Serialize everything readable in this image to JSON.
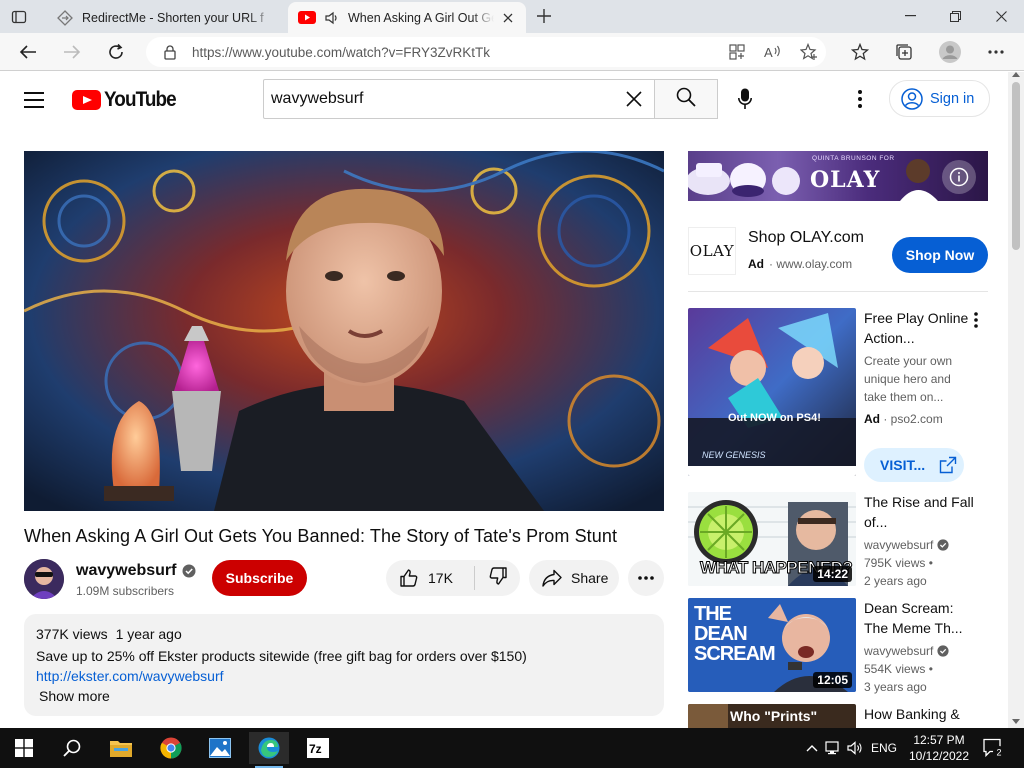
{
  "browser": {
    "tabs": [
      {
        "title": "RedirectMe - Shorten your URL f",
        "active": false
      },
      {
        "title": "When Asking A Girl Out Gets You",
        "active": true
      }
    ],
    "url": "https://www.youtube.com/watch?v=FRY3ZvRKtTk"
  },
  "youtube": {
    "logo_text": "YouTube",
    "search_value": "wavywebsurf",
    "signin_label": "Sign in"
  },
  "video": {
    "title": "When Asking A Girl Out Gets You Banned: The Story of Tate's Prom Stunt",
    "channel": "wavywebsurf",
    "subscribers": "1.09M subscribers",
    "subscribe_label": "Subscribe",
    "likes": "17K",
    "share_label": "Share",
    "views": "377K views",
    "age": "1 year ago",
    "description_line": "Save up to 25% off Ekster products sitewide (free gift bag for orders over $150)",
    "description_link": "http://ekster.com/wavywebsurf",
    "show_more": "Show more"
  },
  "ad_banner": {
    "brand": "OLAY",
    "tagline": "QUINTA BRUNSON FOR"
  },
  "ad": {
    "logo": "OLAY",
    "title": "Shop OLAY.com",
    "label": "Ad",
    "domain": "www.olay.com",
    "cta": "Shop Now"
  },
  "recommendations": [
    {
      "title": "Free Play Online Action...",
      "desc": "Create your own unique hero and take them on...",
      "ad_label": "Ad",
      "domain": "pso2.com",
      "cta": "VISIT...",
      "thumb_text": "Out NOW on PS4!",
      "thumb_logo": "NEW GENESIS"
    },
    {
      "title": "The Rise and Fall of...",
      "channel": "wavywebsurf",
      "views": "795K views",
      "age": "2 years ago",
      "duration": "14:22",
      "thumb_text": "WHAT HAPPENED?"
    },
    {
      "title": "Dean Scream: The Meme Th...",
      "channel": "wavywebsurf",
      "views": "554K views",
      "age": "3 years ago",
      "duration": "12:05",
      "thumb_text": "THE DEAN SCREAM"
    },
    {
      "title": "How Banking &",
      "thumb_text": "Who \"Prints\""
    }
  ],
  "taskbar": {
    "language": "ENG",
    "time": "12:57 PM",
    "date": "10/12/2022",
    "notifications": "2"
  },
  "colors": {
    "yt_red": "#ff0000",
    "subscribe_red": "#cc0000",
    "link_blue": "#065fd4",
    "chrome_gray": "#dfe3e8"
  }
}
